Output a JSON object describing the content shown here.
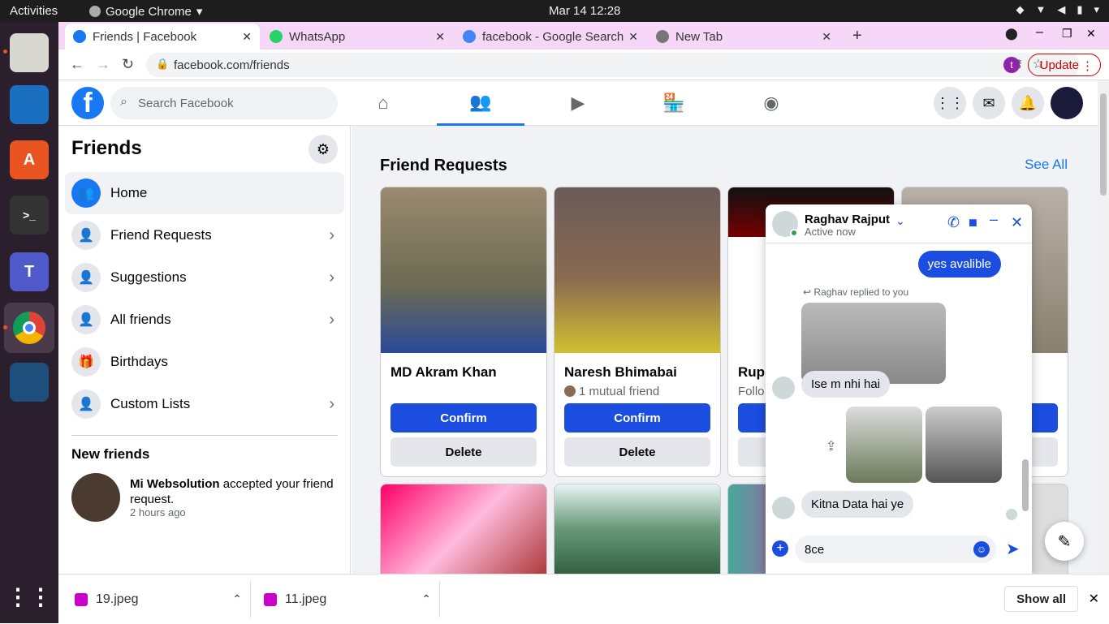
{
  "system": {
    "activities": "Activities",
    "app_name": "Google Chrome",
    "clock": "Mar 14  12:28"
  },
  "tabs": [
    {
      "title": "Friends | Facebook"
    },
    {
      "title": "WhatsApp"
    },
    {
      "title": "facebook - Google Search"
    },
    {
      "title": "New Tab"
    }
  ],
  "address": {
    "url": "facebook.com/friends",
    "profile_initial": "t",
    "update_label": "Update"
  },
  "fb_header": {
    "logo": "f",
    "search_placeholder": "Search Facebook"
  },
  "sidebar": {
    "title": "Friends",
    "items": [
      {
        "label": "Home"
      },
      {
        "label": "Friend Requests"
      },
      {
        "label": "Suggestions"
      },
      {
        "label": "All friends"
      },
      {
        "label": "Birthdays"
      },
      {
        "label": "Custom Lists"
      }
    ],
    "new_friends_heading": "New friends",
    "notification": {
      "name": "Mi Websolution",
      "text": " accepted your friend request.",
      "time": "2 hours ago"
    }
  },
  "main": {
    "heading": "Friend Requests",
    "see_all": "See All",
    "cards": [
      {
        "name": "MD Akram Khan",
        "mutual": "",
        "confirm": "Confirm",
        "delete": "Delete"
      },
      {
        "name": "Naresh Bhimabai",
        "mutual": "1 mutual friend",
        "confirm": "Confirm",
        "delete": "Delete"
      },
      {
        "name": "Rups",
        "mutual": "Follo",
        "confirm": "",
        "delete": ""
      }
    ]
  },
  "chat": {
    "name": "Raghav Rajput",
    "status": "Active now",
    "reply_note": "Raghav replied to you",
    "messages": [
      {
        "text": "yes avalible"
      },
      {
        "text": "Ise m nhi hai"
      },
      {
        "text": "Kitna Data hai ye"
      }
    ],
    "input_value": "8ce"
  },
  "downloads": {
    "items": [
      {
        "name": "19.jpeg"
      },
      {
        "name": "11.jpeg"
      }
    ],
    "show_all": "Show all"
  }
}
